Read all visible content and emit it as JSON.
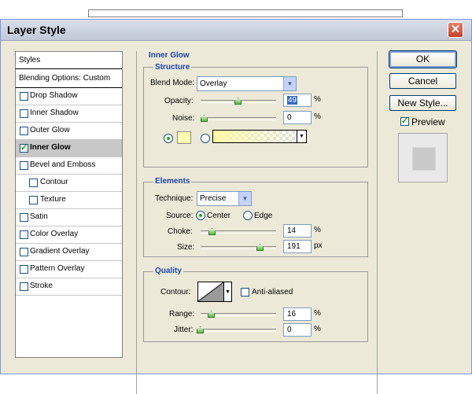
{
  "window": {
    "title": "Layer Style"
  },
  "sidebar": {
    "header": "Styles",
    "blending": "Blending Options: Custom",
    "items": [
      {
        "label": "Drop Shadow",
        "checked": false,
        "indent": false
      },
      {
        "label": "Inner Shadow",
        "checked": false,
        "indent": false
      },
      {
        "label": "Outer Glow",
        "checked": false,
        "indent": false
      },
      {
        "label": "Inner Glow",
        "checked": true,
        "indent": false,
        "selected": true
      },
      {
        "label": "Bevel and Emboss",
        "checked": false,
        "indent": false
      },
      {
        "label": "Contour",
        "checked": false,
        "indent": true
      },
      {
        "label": "Texture",
        "checked": false,
        "indent": true
      },
      {
        "label": "Satin",
        "checked": false,
        "indent": false
      },
      {
        "label": "Color Overlay",
        "checked": false,
        "indent": false
      },
      {
        "label": "Gradient Overlay",
        "checked": false,
        "indent": false
      },
      {
        "label": "Pattern Overlay",
        "checked": false,
        "indent": false
      },
      {
        "label": "Stroke",
        "checked": false,
        "indent": false
      }
    ]
  },
  "main": {
    "title": "Inner Glow",
    "structure": {
      "label": "Structure",
      "blend_mode_label": "Blend Mode:",
      "blend_mode_value": "Overlay",
      "opacity_label": "Opacity:",
      "opacity_value": "49",
      "noise_label": "Noise:",
      "noise_value": "0",
      "unit_percent": "%",
      "glow_color": "#fffbb0"
    },
    "elements": {
      "label": "Elements",
      "technique_label": "Technique:",
      "technique_value": "Precise",
      "source_label": "Source:",
      "source_center": "Center",
      "source_edge": "Edge",
      "choke_label": "Choke:",
      "choke_value": "14",
      "size_label": "Size:",
      "size_value": "191",
      "unit_percent": "%",
      "unit_px": "px"
    },
    "quality": {
      "label": "Quality",
      "contour_label": "Contour:",
      "antialias_label": "Anti-aliased",
      "range_label": "Range:",
      "range_value": "16",
      "jitter_label": "Jitter:",
      "jitter_value": "0",
      "unit_percent": "%"
    }
  },
  "buttons": {
    "ok": "OK",
    "cancel": "Cancel",
    "new_style": "New Style...",
    "preview_label": "Preview"
  }
}
